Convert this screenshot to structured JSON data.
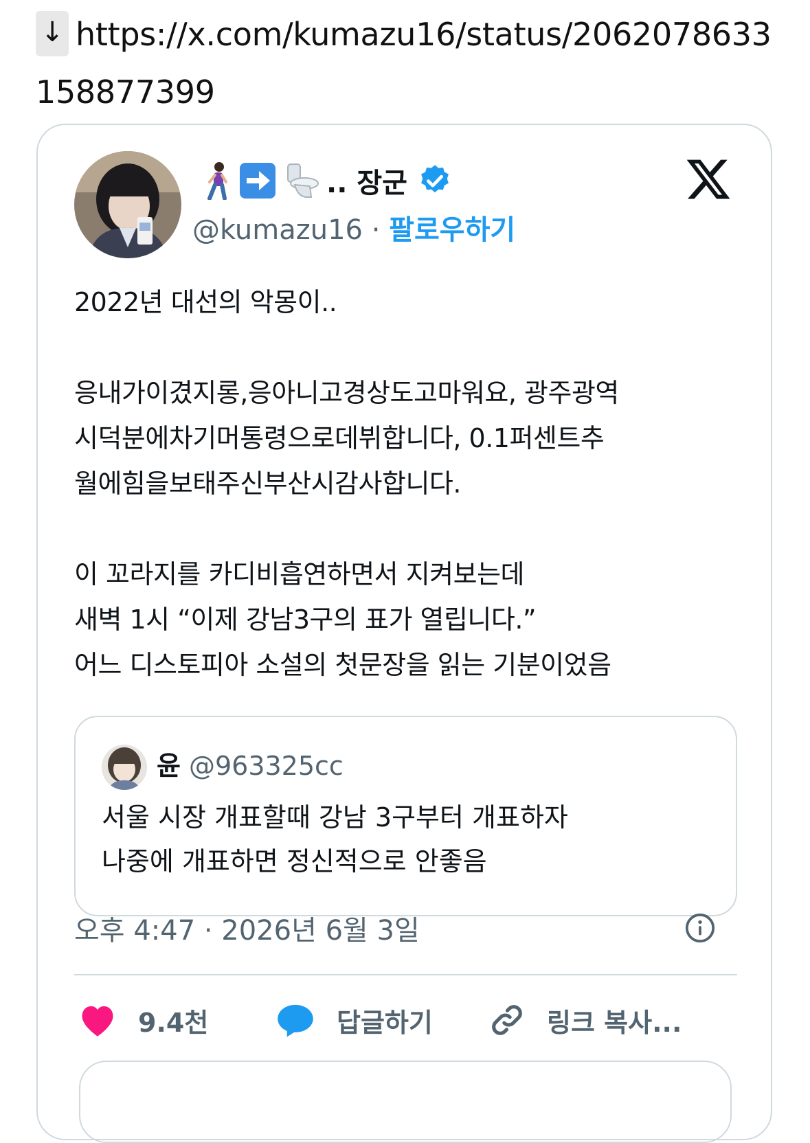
{
  "link": {
    "arrow": "↓",
    "url": "https://x.com/kumazu16/status/2062078633158877399"
  },
  "tweet": {
    "display_name": ".. 장군",
    "name_emojis": [
      "person-walking-icon",
      "arrow-right-icon",
      "toilet-icon"
    ],
    "handle": "@kumazu16",
    "separator": "·",
    "follow_label": "팔로우하기",
    "text": "2022년 대선의 악몽이..\n\n응내가이겼지롱,응아니고경상도고마워요, 광주광역\n시덕분에차기머통령으로데뷔합니다, 0.1퍼센트추\n월에힘을보태주신부산시감사합니다.\n\n이 꼬라지를 카디비흡연하면서 지켜보는데\n새벽 1시 “이제 강남3구의 표가 열립니다.”\n어느 디스토피아 소설의 첫문장을 읽는 기분이었음",
    "timestamp": "오후 4:47 · 2026년 6월 3일"
  },
  "quote": {
    "name": "윤",
    "handle": "@963325cc",
    "text": "서울 시장 개표할때 강남 3구부터 개표하자\n나중에 개표하면 정신적으로 안좋음"
  },
  "actions": {
    "like_count": "9.4천",
    "reply_label": "답글하기",
    "copy_label": "링크 복사..."
  },
  "colors": {
    "accent": "#1d9bf0",
    "like": "#f91880",
    "muted": "#536471",
    "border": "#cfd9de"
  }
}
